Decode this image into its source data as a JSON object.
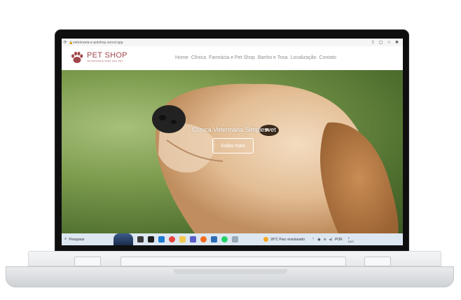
{
  "browser": {
    "url": "veterinaria-e-petshop.vercel.app",
    "reload_icon": "reload-icon",
    "lock_icon": "lock-icon"
  },
  "site": {
    "logo_title": "PET SHOP",
    "logo_subtitle": "VETERINÁRIA PARA SEU PET",
    "nav": [
      "Home",
      "Clínica",
      "Farmácia e Pet Shop",
      "Banho e Tosa",
      "Localização",
      "Contato"
    ]
  },
  "hero": {
    "title": "Clínica Veterinária Simplesvet",
    "button_label": "Saiba mais"
  },
  "taskbar": {
    "search_placeholder": "Pesquisar",
    "weather": "26°C  Parc ensolarado",
    "language": "POR",
    "clock_line1": "1",
    "clock_line2": "12/0"
  },
  "colors": {
    "brand": "#a0474b",
    "nav_text": "#8f8f8f",
    "taskbar": "#dde7f2"
  }
}
